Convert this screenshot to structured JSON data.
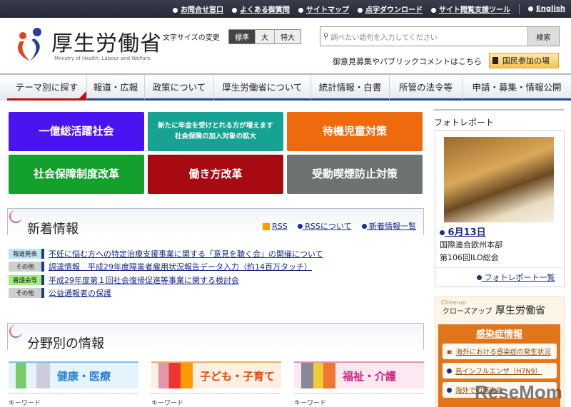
{
  "topbar": {
    "links": [
      "お問合せ窓口",
      "よくある御質問",
      "サイトマップ",
      "点字ダウンロード",
      "サイト閲覧支援ツール"
    ],
    "english": "English"
  },
  "header": {
    "logo_title": "厚生労働省",
    "logo_sub": "Ministry of Health, Labour and Welfare",
    "fontsize_label": "文字サイズの変更",
    "fontsize_options": [
      "標準",
      "大",
      "特大"
    ],
    "search_placeholder": "調べたい語句を入力してください",
    "search_button": "検索",
    "public_comment_text": "御意見募集やパブリックコメントはこちら",
    "public_comment_button": "国民参加の場"
  },
  "nav": [
    "テーマ別に探す",
    "報道・広報",
    "政策について",
    "厚生労働省について",
    "統計情報・白書",
    "所管の法令等",
    "申請・募集・情報公開"
  ],
  "tiles": [
    {
      "label": "一億総活躍社会",
      "color": "#4a14f0"
    },
    {
      "label": "新たに年金を受けとれる方が増えます",
      "label2": "社会保険の加入対象の拡大",
      "color": "#17a394"
    },
    {
      "label": "待機児童対策",
      "color": "#ef6a0c"
    },
    {
      "label": "社会保障制度改革",
      "color": "#13a02c"
    },
    {
      "label": "働き方改革",
      "color": "#a80a12"
    },
    {
      "label": "受動喫煙防止対策",
      "color": "#6e7272"
    }
  ],
  "news": {
    "title": "新着情報",
    "rss": "RSS",
    "rss_about": "RSSについて",
    "list_link": "新着情報一覧",
    "items": [
      {
        "badge": "報道発表",
        "badge_color": "#bfe4f6",
        "text": "不妊に悩む方への特定治療支援事業に関する「意見を聴く会」の開催について"
      },
      {
        "badge": "その他",
        "badge_color": "#cfcfcf",
        "text": "調達情報　平成29年度障害者雇用状況報告データ入力（約14百万タッチ）"
      },
      {
        "badge": "審議会等",
        "badge_color": "#9ef07a",
        "text": "平成29年度第１回社会復帰促進等事業に関する検討会"
      },
      {
        "badge": "その他",
        "badge_color": "#cfcfcf",
        "text": "公益通報者の保護"
      }
    ]
  },
  "fields": {
    "title": "分野別の情報",
    "categories": [
      {
        "label": "健康・医療",
        "color": "#2a7fd6",
        "bg": "#e4f3fc",
        "line": "#7fc0e8"
      },
      {
        "label": "子ども・子育て",
        "color": "#e0480e",
        "bg": "#fdf0e2",
        "line": "#f0b060"
      },
      {
        "label": "福祉・介護",
        "color": "#d6207a",
        "bg": "#fce8f0",
        "line": "#e890b8"
      }
    ],
    "keyword": "キーワード"
  },
  "photo": {
    "heading": "フォトレポート",
    "date": "6月13日",
    "line1": "国際連合欧州本部",
    "line2": "第106回ILO総会",
    "list_link": "フォトレポート一覧"
  },
  "closeup": {
    "small": "Close-up",
    "title_kana": "クローズアップ",
    "title": "厚生労働省",
    "section": "感染症情報",
    "items": [
      "海外における感染症の発生状況",
      "鳥インフルエンザ（H7N9）",
      "海外での感染症"
    ]
  },
  "watermark": "ReseMom"
}
